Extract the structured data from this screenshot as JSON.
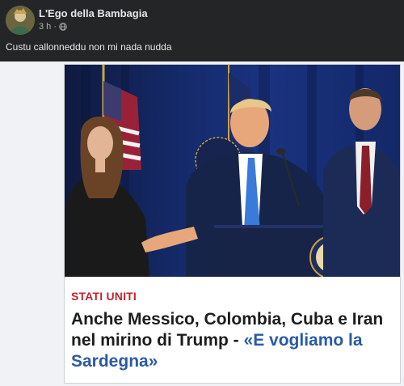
{
  "post": {
    "author": "L'Ego della Bambagia",
    "time": "3 h",
    "privacy_icon": "globe-icon",
    "text": "Custu callonneddu non mi nada nudda"
  },
  "article": {
    "kicker": "STATI UNITI",
    "headline": "Anche Messico, Colombia, Cuba e Iran nel mirino di Trump - ",
    "quote": "«E vogliamo la Sardegna»",
    "colors": {
      "kicker": "#c0262d",
      "quote": "#2a5aa5"
    }
  }
}
